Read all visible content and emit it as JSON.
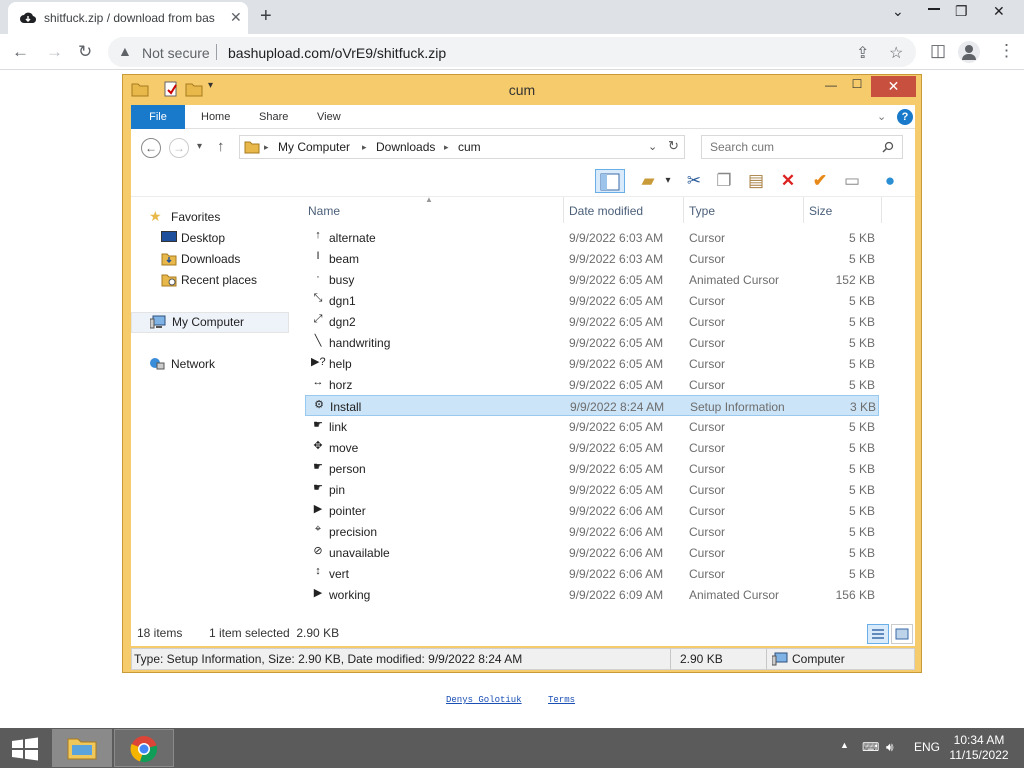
{
  "browser": {
    "tab_title": "shitfuck.zip / download from bas",
    "security_label": "Not secure",
    "url": "bashupload.com/oVrE9/shitfuck.zip"
  },
  "explorer": {
    "title": "cum",
    "ribbon_tabs": [
      "File",
      "Home",
      "Share",
      "View"
    ],
    "breadcrumb": [
      "My Computer",
      "Downloads",
      "cum"
    ],
    "search_placeholder": "Search cum",
    "nav": {
      "favorites": "Favorites",
      "desktop": "Desktop",
      "downloads": "Downloads",
      "recent": "Recent places",
      "computer": "My Computer",
      "network": "Network"
    },
    "columns": [
      "Name",
      "Date modified",
      "Type",
      "Size"
    ],
    "files": [
      {
        "name": "alternate",
        "date": "9/9/2022 6:03 AM",
        "type": "Cursor",
        "size": "5 KB",
        "icon": "↑"
      },
      {
        "name": "beam",
        "date": "9/9/2022 6:03 AM",
        "type": "Cursor",
        "size": "5 KB",
        "icon": "I"
      },
      {
        "name": "busy",
        "date": "9/9/2022 6:05 AM",
        "type": "Animated Cursor",
        "size": "152 KB",
        "icon": "·"
      },
      {
        "name": "dgn1",
        "date": "9/9/2022 6:05 AM",
        "type": "Cursor",
        "size": "5 KB",
        "icon": "⤡"
      },
      {
        "name": "dgn2",
        "date": "9/9/2022 6:05 AM",
        "type": "Cursor",
        "size": "5 KB",
        "icon": "⤢"
      },
      {
        "name": "handwriting",
        "date": "9/9/2022 6:05 AM",
        "type": "Cursor",
        "size": "5 KB",
        "icon": "╲"
      },
      {
        "name": "help",
        "date": "9/9/2022 6:05 AM",
        "type": "Cursor",
        "size": "5 KB",
        "icon": "▶?"
      },
      {
        "name": "horz",
        "date": "9/9/2022 6:05 AM",
        "type": "Cursor",
        "size": "5 KB",
        "icon": "↔"
      },
      {
        "name": "Install",
        "date": "9/9/2022 8:24 AM",
        "type": "Setup Information",
        "size": "3 KB",
        "icon": "⚙"
      },
      {
        "name": "link",
        "date": "9/9/2022 6:05 AM",
        "type": "Cursor",
        "size": "5 KB",
        "icon": "☛"
      },
      {
        "name": "move",
        "date": "9/9/2022 6:05 AM",
        "type": "Cursor",
        "size": "5 KB",
        "icon": "✥"
      },
      {
        "name": "person",
        "date": "9/9/2022 6:05 AM",
        "type": "Cursor",
        "size": "5 KB",
        "icon": "☛"
      },
      {
        "name": "pin",
        "date": "9/9/2022 6:05 AM",
        "type": "Cursor",
        "size": "5 KB",
        "icon": "☛"
      },
      {
        "name": "pointer",
        "date": "9/9/2022 6:06 AM",
        "type": "Cursor",
        "size": "5 KB",
        "icon": "▶"
      },
      {
        "name": "precision",
        "date": "9/9/2022 6:06 AM",
        "type": "Cursor",
        "size": "5 KB",
        "icon": "⌖"
      },
      {
        "name": "unavailable",
        "date": "9/9/2022 6:06 AM",
        "type": "Cursor",
        "size": "5 KB",
        "icon": "⊘"
      },
      {
        "name": "vert",
        "date": "9/9/2022 6:06 AM",
        "type": "Cursor",
        "size": "5 KB",
        "icon": "↕"
      },
      {
        "name": "working",
        "date": "9/9/2022 6:09 AM",
        "type": "Animated Cursor",
        "size": "156 KB",
        "icon": "▶"
      }
    ],
    "selected_index": 8,
    "status": {
      "item_count": "18 items",
      "selection": "1 item selected  2.90 KB"
    },
    "details": {
      "description": "Type: Setup Information, Size: 2.90 KB, Date modified: 9/9/2022 8:24 AM",
      "size": "2.90 KB",
      "location": "Computer"
    }
  },
  "footer": {
    "author": "Denys Golotiuk",
    "terms": "Terms"
  },
  "taskbar": {
    "language": "ENG",
    "time": "10:34 AM",
    "date": "11/15/2022"
  },
  "colors": {
    "window_frame": "#f5cb6c",
    "ribbon_file": "#1979ca",
    "close_button": "#c7503f",
    "selection": "#cce4f7",
    "taskbar": "#5b5b5b"
  }
}
